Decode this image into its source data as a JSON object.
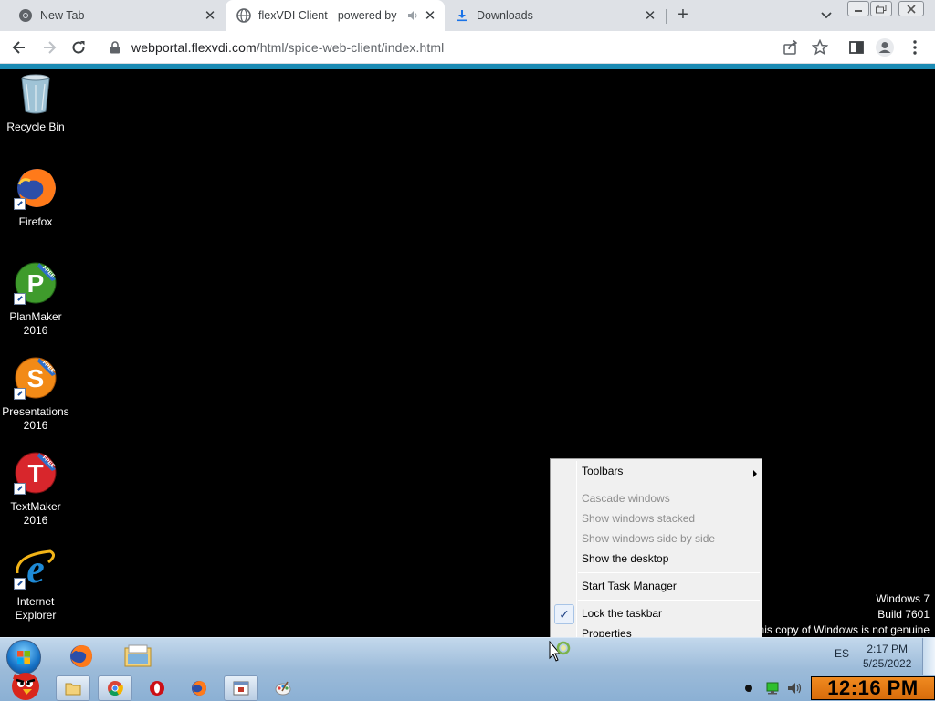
{
  "browser": {
    "tabs": [
      {
        "title": "New Tab",
        "icon": "chrome-icon",
        "active": false
      },
      {
        "title": "flexVDI Client - powered by",
        "icon": "globe-icon",
        "active": true,
        "audio": true
      },
      {
        "title": "Downloads",
        "icon": "download-icon",
        "active": false
      }
    ],
    "url_host": "webportal.flexvdi.com",
    "url_path": "/html/spice-web-client/index.html",
    "accent_color": "#1b8bb4"
  },
  "desktop": {
    "icons": [
      {
        "label": "Recycle Bin",
        "icon": "recycle-bin-icon"
      },
      {
        "label": "Firefox",
        "icon": "firefox-icon"
      },
      {
        "label": "PlanMaker 2016",
        "icon": "planmaker-icon",
        "letter": "P",
        "badge": "FREE"
      },
      {
        "label": "Presentations 2016",
        "icon": "presentations-icon",
        "letter": "S",
        "badge": "FREE"
      },
      {
        "label": "TextMaker 2016",
        "icon": "textmaker-icon",
        "letter": "T",
        "badge": "FREE"
      },
      {
        "label": "Internet Explorer",
        "icon": "internet-explorer-icon"
      }
    ],
    "watermark": {
      "line1": "Windows 7",
      "line2": "Build 7601",
      "line3": "his copy of Windows is not genuine"
    }
  },
  "context_menu": {
    "toolbars": "Toolbars",
    "cascade": "Cascade windows",
    "stacked": "Show windows stacked",
    "side_by_side": "Show windows side by side",
    "show_desktop": "Show the desktop",
    "task_manager": "Start Task Manager",
    "lock_taskbar": "Lock the taskbar",
    "lock_taskbar_checked": true,
    "properties": "Properties",
    "check_mark": "✓"
  },
  "taskbar": {
    "language": "ES",
    "time": "2:17 PM",
    "date": "5/25/2022",
    "big_clock": "12:16 PM",
    "pinned_top": [
      "firefox-icon",
      "file-explorer-icon"
    ],
    "pinned_bottom": [
      "folder-icon",
      "chrome-icon",
      "opera-icon",
      "firefox-icon",
      "app-window-icon",
      "paint-icon"
    ]
  }
}
